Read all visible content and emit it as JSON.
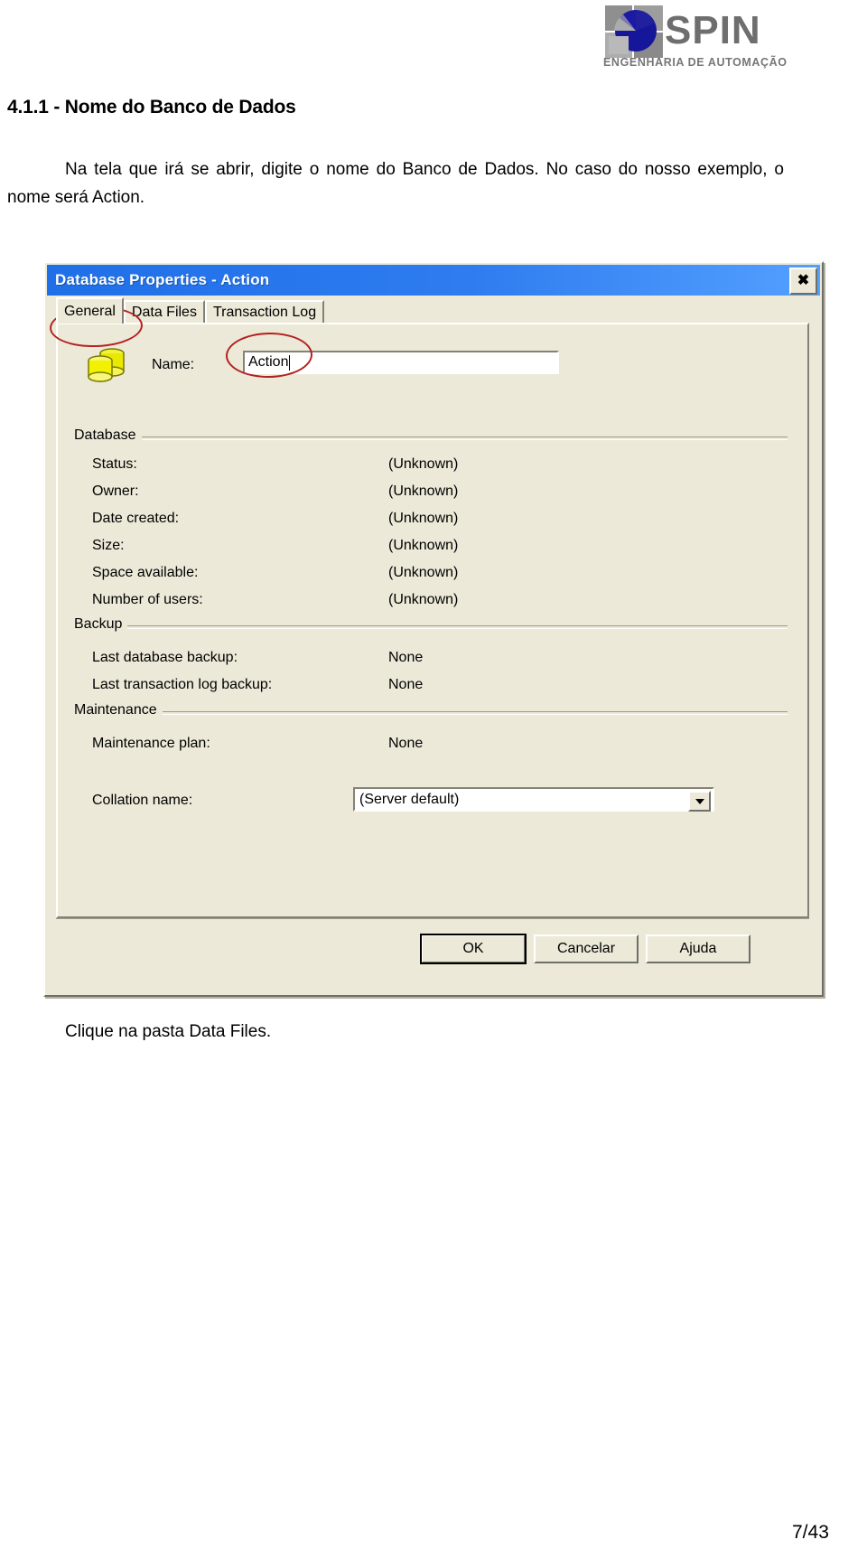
{
  "logo": {
    "wordmark": "SPIN",
    "tagline": "ENGENHARIA DE AUTOMAÇÃO",
    "mark_icon": "spin-circle-icon",
    "colors": {
      "mark_blue": "#1a1a8c",
      "mark_grey": "#9a9a9a",
      "text_grey": "#6e6e6e"
    }
  },
  "document": {
    "heading": "4.1.1 - Nome do Banco de Dados",
    "paragraph": "Na tela que irá se abrir, digite o nome do Banco de Dados. No caso do nosso exemplo, o nome será Action.",
    "footer_note": "Clique na pasta Data Files.",
    "page_number": "7/43"
  },
  "dialog": {
    "title": "Database Properties - Action",
    "close_label": "✖",
    "tabs": [
      {
        "label": "General",
        "active": true
      },
      {
        "label": "Data Files",
        "active": false
      },
      {
        "label": "Transaction Log",
        "active": false
      }
    ],
    "icon": "database-cylinder-icon",
    "name_field": {
      "label": "Name:",
      "value": "Action"
    },
    "groups": [
      {
        "label": "Database",
        "rows": [
          {
            "key": "Status:",
            "value": "(Unknown)"
          },
          {
            "key": "Owner:",
            "value": "(Unknown)"
          },
          {
            "key": "Date created:",
            "value": "(Unknown)"
          },
          {
            "key": "Size:",
            "value": "(Unknown)"
          },
          {
            "key": "Space available:",
            "value": "(Unknown)"
          },
          {
            "key": "Number of users:",
            "value": "(Unknown)"
          }
        ]
      },
      {
        "label": "Backup",
        "rows": [
          {
            "key": "Last database backup:",
            "value": "None"
          },
          {
            "key": "Last transaction log backup:",
            "value": "None"
          }
        ]
      },
      {
        "label": "Maintenance",
        "rows": [
          {
            "key": "Maintenance plan:",
            "value": "None"
          },
          {
            "key": "Collation name:",
            "value": ""
          }
        ]
      }
    ],
    "collation": {
      "label": "Collation name:",
      "value": "(Server default)",
      "arrow_icon": "chevron-down-icon"
    },
    "buttons": {
      "ok": "OK",
      "cancel": "Cancelar",
      "help": "Ajuda"
    },
    "colors": {
      "titlebar_start": "#1f6fe8",
      "titlebar_end": "#53a0ff",
      "face": "#ece9d8",
      "annotation_red": "#b42020"
    }
  }
}
